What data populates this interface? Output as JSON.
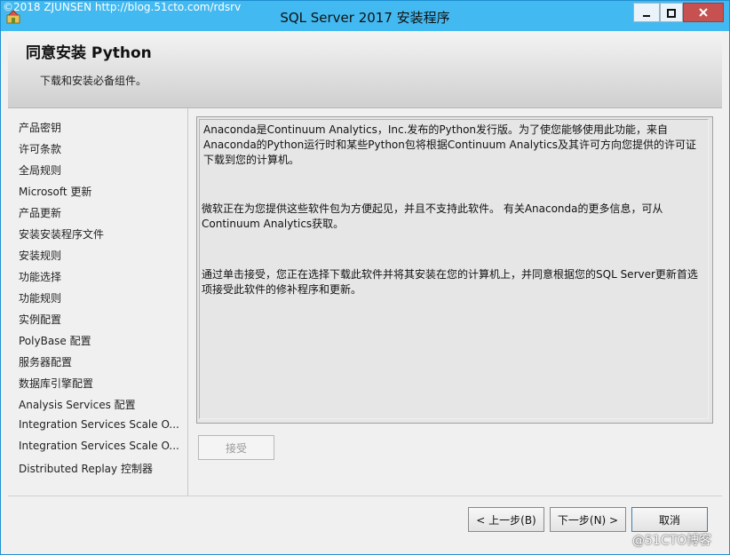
{
  "watermark": "©2018 ZJUNSEN http://blog.51cto.com/rdsrv",
  "window": {
    "title": "SQL Server 2017 安装程序"
  },
  "header": {
    "title": "同意安装 Python",
    "subtitle": "下载和安装必备组件。"
  },
  "nav": {
    "items": [
      "产品密钥",
      "许可条款",
      "全局规则",
      "Microsoft 更新",
      "产品更新",
      "安装安装程序文件",
      "安装规则",
      "功能选择",
      "功能规则",
      "实例配置",
      "PolyBase 配置",
      "服务器配置",
      "数据库引擎配置",
      "Analysis Services 配置",
      "Integration Services Scale O...",
      "Integration Services Scale O...",
      "Distributed Replay 控制器"
    ]
  },
  "content": {
    "paragraph1": "Anaconda是Continuum Analytics，Inc.发布的Python发行版。为了使您能够使用此功能，来自Anaconda的Python运行时和某些Python包将根据Continuum Analytics及其许可方向您提供的许可证下载到您的计算机。",
    "paragraph2": "微软正在为您提供这些软件包为方便起见，并且不支持此软件。 有关Anaconda的更多信息，可从Continuum Analytics获取。",
    "paragraph3": "通过单击接受，您正在选择下载此软件并将其安装在您的计算机上，并同意根据您的SQL Server更新首选项接受此软件的修补程序和更新。"
  },
  "buttons": {
    "accept": "接受",
    "back": "< 上一步(B)",
    "next": "下一步(N) >",
    "cancel": "取消"
  },
  "corner_watermark": "@51CTO博客",
  "colors": {
    "titlebar": "#42b9f0",
    "close_button": "#c75050"
  }
}
